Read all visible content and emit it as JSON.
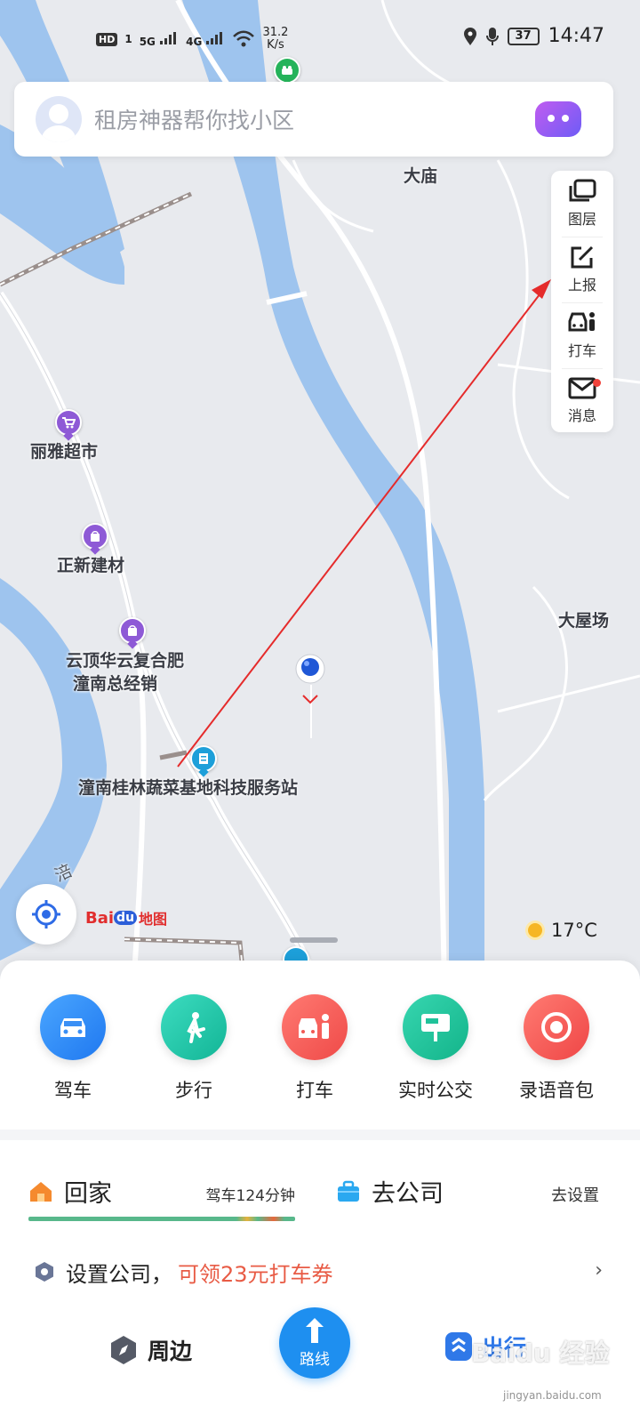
{
  "status_bar": {
    "hd": "HD",
    "sim": "1",
    "sig1": "5G",
    "sig2": "4G",
    "net_speed": "31.2",
    "net_unit": "K/s",
    "battery": "37",
    "time": "14:47"
  },
  "search": {
    "placeholder": "租房神器帮你找小区"
  },
  "tools": [
    {
      "label": "图层",
      "icon": "layers-icon"
    },
    {
      "label": "上报",
      "icon": "report-edit-icon"
    },
    {
      "label": "打车",
      "icon": "taxi-icon"
    },
    {
      "label": "消息",
      "icon": "mail-icon"
    }
  ],
  "map": {
    "labels": {
      "damiao": "大庙",
      "dawuchang": "大屋场",
      "liya": "丽雅超市",
      "zhengxin": "正新建材",
      "yunding_1": "云顶华云复合肥",
      "yunding_2": "潼南总经销",
      "station": "潼南桂林蔬菜基地科技服务站",
      "river": "涪"
    },
    "brand": {
      "bai": "Bai",
      "du": "du",
      "ditu": "地图"
    },
    "weather": "17°C"
  },
  "quick_actions": [
    {
      "label": "驾车",
      "icon": "car-icon",
      "color": "#2d8cf0"
    },
    {
      "label": "步行",
      "icon": "walk-icon",
      "color": "#21c3a6"
    },
    {
      "label": "打车",
      "icon": "taxi-icon",
      "color": "#f05a55"
    },
    {
      "label": "实时公交",
      "icon": "bus-stop-icon",
      "color": "#20c29a"
    },
    {
      "label": "录语音包",
      "icon": "record-icon",
      "color": "#f55a5a"
    }
  ],
  "commute": {
    "home_label": "回家",
    "home_time": "驾车124分钟",
    "work_label": "去公司",
    "work_action": "去设置"
  },
  "promo": {
    "text": "设置公司，",
    "highlight": "可领23元打车券",
    "arrow": "›"
  },
  "bottom_nav": {
    "nearby": "周边",
    "route": "路线",
    "travel": "出行"
  },
  "watermark": {
    "text": "Baidu 经验",
    "url": "jingyan.baidu.com"
  },
  "colors": {
    "accent_blue": "#1e8ff0",
    "river": "#9ec4ee",
    "annotation_arrow": "#e52b2b"
  }
}
